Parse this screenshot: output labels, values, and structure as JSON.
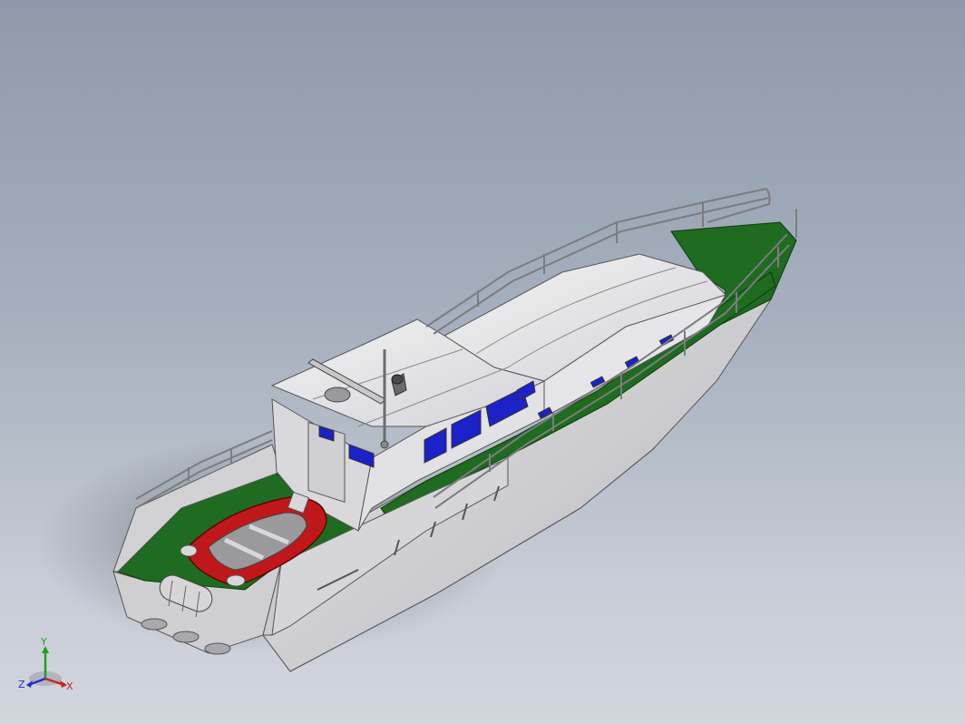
{
  "window": {
    "title": ""
  },
  "model": {
    "name": "",
    "colors": {
      "background_top": "#8e9aab",
      "background_bottom": "#d2d6dd",
      "hull_bottom": "#0a1aa8",
      "hull_side": "#d8d8da",
      "deck": "#1f6b1f",
      "superstructure": "#e6e6e8",
      "window_glass": "#1a22c8",
      "dinghy_tube": "#c0181a",
      "railing": "#7c7c80"
    }
  },
  "triad": {
    "x_label": "X",
    "y_label": "Y",
    "z_label": "Z",
    "x_color": "#d02020",
    "y_color": "#20a020",
    "z_color": "#2030d0"
  }
}
